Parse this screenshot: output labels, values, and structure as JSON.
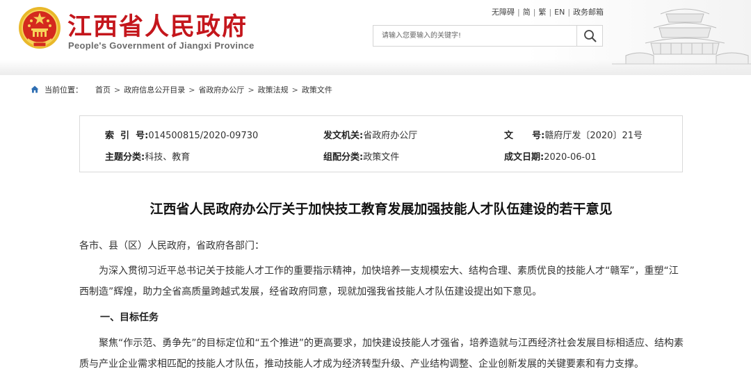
{
  "header": {
    "site_title": "江西省人民政府",
    "site_subtitle": "People's Government of Jiangxi Province",
    "emblem_icon": "national-emblem-icon",
    "colors": {
      "title_red": "#c4161c",
      "emblem_gold": "#f2c230"
    }
  },
  "top_links": {
    "items": [
      "无障碍",
      "简",
      "繁",
      "EN",
      "政务邮箱"
    ]
  },
  "search": {
    "placeholder": "请输入您要输入的关键字!",
    "button_icon": "search-icon"
  },
  "breadcrumb": {
    "label": "当前位置：",
    "items": [
      "首页",
      "政府信息公开目录",
      "省政府办公厅",
      "政策法规",
      "政策文件"
    ]
  },
  "meta": {
    "index_key": "索  引  号:",
    "index_val": "014500815/2020-09730",
    "issuer_key": "发文机关:",
    "issuer_val": "省政府办公厅",
    "docno_key": "文      号:",
    "docno_val": "赣府厅发〔2020〕21号",
    "topic_key": "主题分类:",
    "topic_val": "科技、教育",
    "org_key": "组配分类:",
    "org_val": "政策文件",
    "date_key": "成文日期:",
    "date_val": "2020-06-01"
  },
  "article": {
    "title": "江西省人民政府办公厅关于加快技工教育发展加强技能人才队伍建设的若干意见",
    "salutation": "各市、县（区）人民政府，省政府各部门：",
    "para1": "为深入贯彻习近平总书记关于技能人才工作的重要指示精神，加快培养一支规模宏大、结构合理、素质优良的技能人才“赣军”，重塑“江西制造”辉煌，助力全省高质量跨越式发展，经省政府同意，现就加强我省技能人才队伍建设提出如下意见。",
    "heading1": "一、目标任务",
    "para2": "聚焦“作示范、勇争先”的目标定位和“五个推进”的更高要求，加快建设技能人才强省，培养造就与江西经济社会发展目标相适应、结构素质与产业企业需求相匹配的技能人才队伍，推动技能人才成为经济转型升级、产业结构调整、企业创新发展的关键要素和有力支撑。"
  }
}
